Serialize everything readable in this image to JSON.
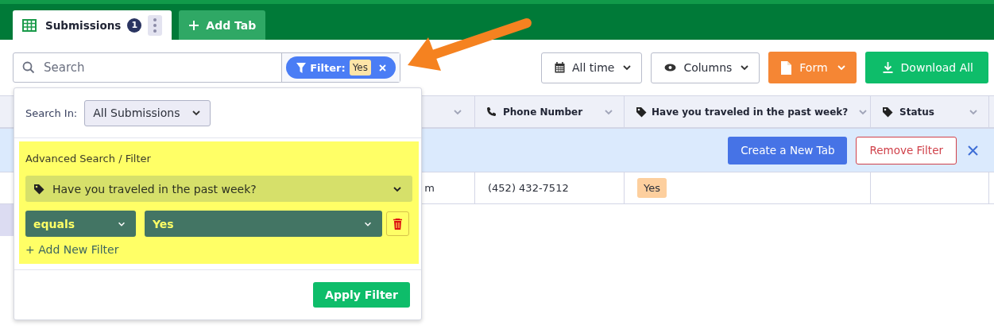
{
  "tabs": [
    {
      "label": "Submissions",
      "badge": "1",
      "selected": true
    }
  ],
  "add_tab": "Add Tab",
  "search": {
    "placeholder": "Search"
  },
  "filter_chip": {
    "label": "Filter:",
    "value": "Yes"
  },
  "toolbar": {
    "date": "All time",
    "columns": "Columns",
    "form": "Form",
    "download": "Download All"
  },
  "table": {
    "columns": [
      {},
      {
        "label": "Phone Number"
      },
      {
        "label": "Have you traveled in the past week?"
      },
      {
        "label": "Status"
      }
    ],
    "banner": {
      "create": "Create a New Tab",
      "remove": "Remove Filter"
    },
    "rows": [
      {
        "cells": [
          "m",
          "(452) 432-7512",
          "Yes"
        ]
      }
    ]
  },
  "popup": {
    "search_in_label": "Search In:",
    "search_in_value": "All Submissions",
    "section_title": "Advanced Search / Filter",
    "field": "Have you traveled in the past week?",
    "operator": "equals",
    "value": "Yes",
    "add_filter": "+ Add New Filter",
    "apply": "Apply Filter"
  }
}
